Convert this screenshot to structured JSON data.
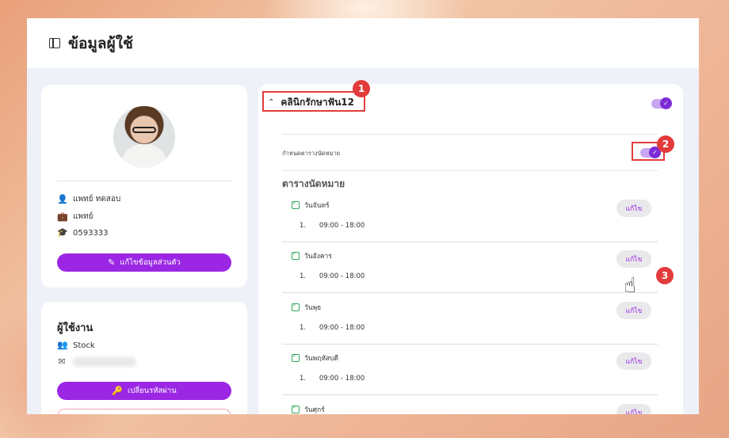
{
  "page": {
    "title": "ข้อมูลผู้ใช้"
  },
  "profile": {
    "name": "แพทย์ ทดสอบ",
    "role": "แพทย์",
    "license": "0593333",
    "edit_label": "แก้ไขข้อมูลส่วนตัว"
  },
  "user": {
    "title": "ผู้ใช้งาน",
    "group": "Stock",
    "change_password_label": "เปลี่ยนรหัสผ่าน"
  },
  "clinic": {
    "name": "คลินิกรักษาฟัน12",
    "appointment_setting_label": "กำหนดตารางนัดหมาย",
    "schedule_title": "ตารางนัดหมาย",
    "days": [
      {
        "name": "วันจันทร์",
        "slots": [
          {
            "index": "1.",
            "time": "09:00 - 18:00"
          }
        ],
        "edit": "แก้ไข"
      },
      {
        "name": "วันอังคาร",
        "slots": [
          {
            "index": "1.",
            "time": "09:00 - 18:00"
          }
        ],
        "edit": "แก้ไข"
      },
      {
        "name": "วันพุธ",
        "slots": [
          {
            "index": "1.",
            "time": "09:00 - 18:00"
          }
        ],
        "edit": "แก้ไข"
      },
      {
        "name": "วันพฤหัสบดี",
        "slots": [
          {
            "index": "1.",
            "time": "09:00 - 18:00"
          }
        ],
        "edit": "แก้ไข"
      },
      {
        "name": "วันศุกร์",
        "slots": [],
        "edit": "แก้ไข"
      }
    ]
  },
  "annotations": {
    "step1": "1",
    "step2": "2",
    "step3": "3"
  },
  "colors": {
    "accent": "#9b27e4",
    "annotation": "#e23b3b",
    "toggle_on": "#7b2cd6"
  }
}
